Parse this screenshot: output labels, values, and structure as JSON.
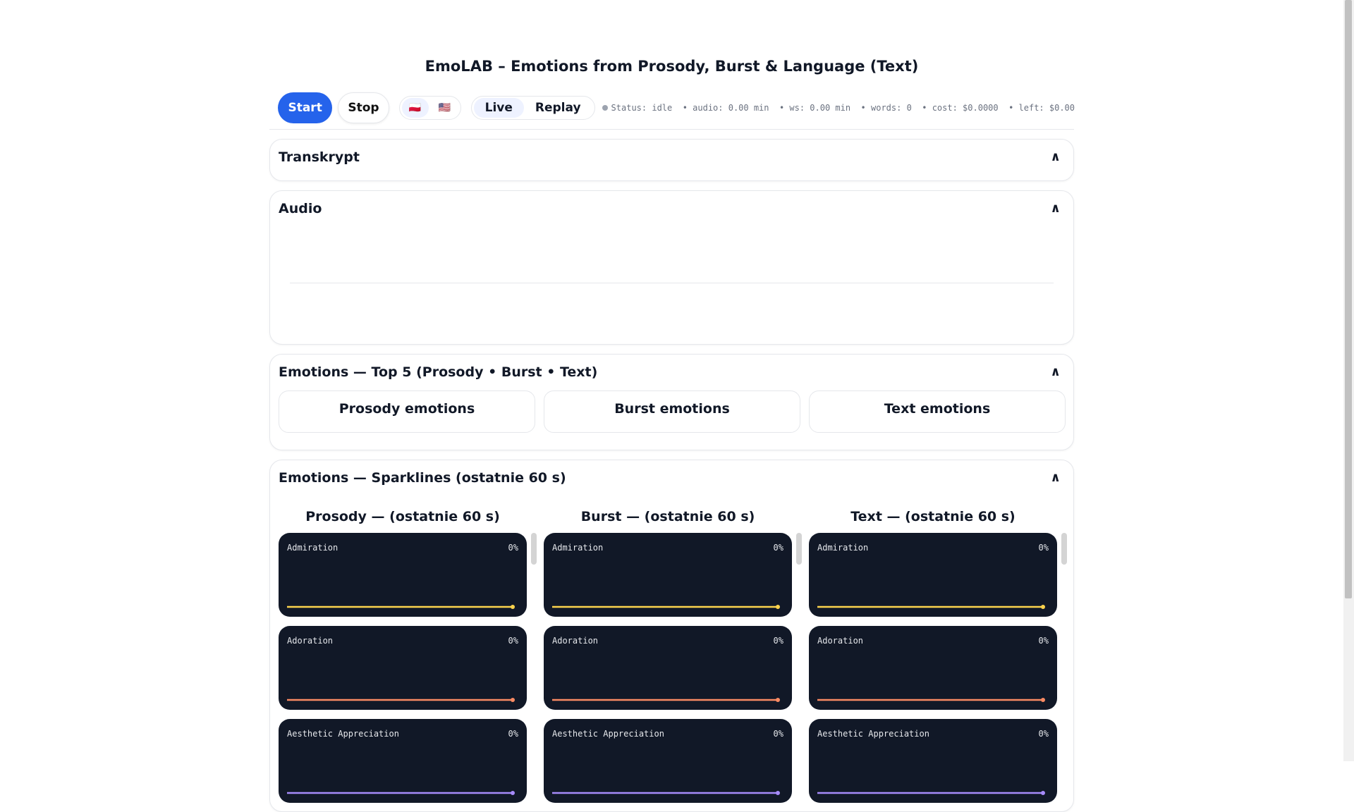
{
  "header": {
    "title": "EmoLAB – Emotions from Prosody, Burst & Language (Text)"
  },
  "toolbar": {
    "start_label": "Start",
    "stop_label": "Stop",
    "languages": [
      {
        "flag": "🇵🇱",
        "name": "pl-flag-icon"
      },
      {
        "flag": "🇺🇸",
        "name": "us-flag-icon"
      }
    ],
    "modes": [
      "Live",
      "Replay"
    ],
    "status": "Status: idle  • audio: 0.00 min  • ws: 0.00 min  • words: 0  • cost: $0.0000  • left: $0.00"
  },
  "sections": {
    "transcript": "Transkrypt",
    "audio": "Audio",
    "top5": "Emotions — Top 5 (Prosody • Burst • Text)",
    "top5_cards": [
      "Prosody emotions",
      "Burst emotions",
      "Text emotions"
    ],
    "sparklines": "Emotions — Sparklines (ostatnie 60 s)",
    "collapse_glyph": "∧"
  },
  "spark_columns": [
    {
      "title": "Prosody — (ostatnie 60 s)"
    },
    {
      "title": "Burst — (ostatnie 60 s)"
    },
    {
      "title": "Text — (ostatnie 60 s)"
    }
  ],
  "spark_items": [
    {
      "name": "Admiration",
      "value": "0%",
      "level": 0,
      "color": "#fcd34d"
    },
    {
      "name": "Adoration",
      "value": "0%",
      "level": 0,
      "color": "#f98a63"
    },
    {
      "name": "Aesthetic Appreciation",
      "value": "0%",
      "level": 0,
      "color": "#a78bfa"
    }
  ]
}
